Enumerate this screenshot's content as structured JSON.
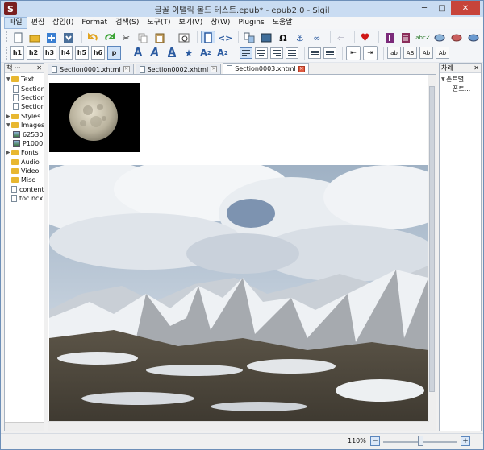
{
  "window": {
    "title": "글꼴 이탤릭 볼드 테스트.epub* - epub2.0 - Sigil",
    "app_icon_letter": "S",
    "controls": {
      "minimize": "─",
      "maximize": "□",
      "close": "✕"
    }
  },
  "menubar": [
    "파일",
    "편집",
    "삽입(I)",
    "Format",
    "검색(S)",
    "도구(T)",
    "보기(V)",
    "창(W)",
    "Plugins",
    "도움말"
  ],
  "heading_buttons": [
    "h1",
    "h2",
    "h3",
    "h4",
    "h5",
    "h6",
    "p"
  ],
  "case_buttons": [
    "ab",
    "AB",
    "Ab",
    "Ab"
  ],
  "book_browser": {
    "header": "책 ···",
    "items": [
      {
        "label": "Text",
        "type": "folder"
      },
      {
        "label": "Section",
        "type": "file"
      },
      {
        "label": "Section",
        "type": "file"
      },
      {
        "label": "Section",
        "type": "file"
      },
      {
        "label": "Styles",
        "type": "folder"
      },
      {
        "label": "Images",
        "type": "folder"
      },
      {
        "label": "62530",
        "type": "image"
      },
      {
        "label": "P1000",
        "type": "image"
      },
      {
        "label": "Fonts",
        "type": "folder"
      },
      {
        "label": "Audio",
        "type": "folder"
      },
      {
        "label": "Video",
        "type": "folder"
      },
      {
        "label": "Misc",
        "type": "folder"
      },
      {
        "label": "content.",
        "type": "file"
      },
      {
        "label": "toc.ncx",
        "type": "file"
      }
    ]
  },
  "toc_pane": {
    "header": "차례",
    "items": [
      "폰트별 ...",
      "폰트..."
    ]
  },
  "tabs": [
    {
      "label": "Section0001.xhtml",
      "active": false
    },
    {
      "label": "Section0002.xhtml",
      "active": false
    },
    {
      "label": "Section0003.xhtml",
      "active": true
    }
  ],
  "status": {
    "zoom": "110%",
    "zoom_level_fraction": 0.47
  }
}
